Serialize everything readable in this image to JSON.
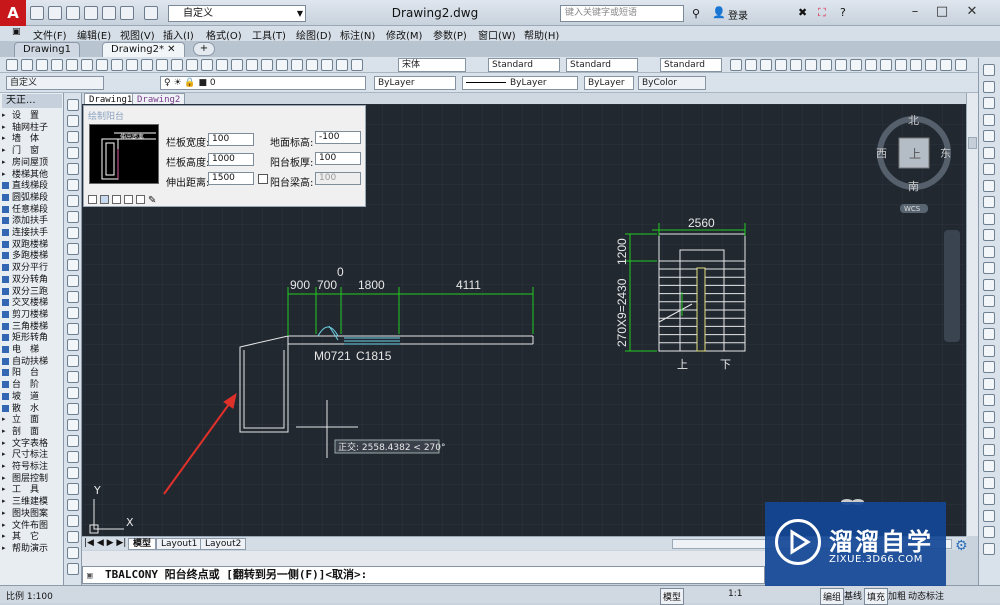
{
  "app": {
    "logo": "A",
    "title": "Drawing2.dwg",
    "workspace": "自定义",
    "search_placeholder": "键入关键字或短语",
    "login": "登录"
  },
  "menu": [
    "文件(F)",
    "编辑(E)",
    "视图(V)",
    "插入(I)",
    "格式(O)",
    "工具(T)",
    "绘图(D)",
    "标注(N)",
    "修改(M)",
    "参数(P)",
    "窗口(W)",
    "帮助(H)"
  ],
  "doc_tabs": [
    {
      "label": "Drawing1",
      "active": false
    },
    {
      "label": "Drawing2*",
      "active": true
    }
  ],
  "toolbar": {
    "font": "宋体",
    "text_style": "Standard",
    "dim_style": "Standard",
    "table_style": "Standard",
    "named_view": "自定义",
    "layer_color": "ByLayer",
    "linetype": "ByLayer",
    "lineweight": "ByLayer",
    "plot_style": "ByColor"
  },
  "tz_panel": {
    "header": "天正...",
    "items": [
      {
        "label": "设　置",
        "type": "grp"
      },
      {
        "label": "轴网柱子",
        "type": "grp"
      },
      {
        "label": "墙　体",
        "type": "grp"
      },
      {
        "label": "门　窗",
        "type": "grp"
      },
      {
        "label": "房间屋顶",
        "type": "grp"
      },
      {
        "label": "楼梯其他",
        "type": "grp"
      },
      {
        "label": "直线梯段",
        "type": "cmd"
      },
      {
        "label": "圆弧梯段",
        "type": "cmd"
      },
      {
        "label": "任意梯段",
        "type": "cmd"
      },
      {
        "label": "添加扶手",
        "type": "cmd"
      },
      {
        "label": "连接扶手",
        "type": "cmd"
      },
      {
        "label": "双跑楼梯",
        "type": "cmd"
      },
      {
        "label": "多跑楼梯",
        "type": "cmd"
      },
      {
        "label": "双分平行",
        "type": "cmd"
      },
      {
        "label": "双分转角",
        "type": "cmd"
      },
      {
        "label": "双分三跑",
        "type": "cmd"
      },
      {
        "label": "交叉楼梯",
        "type": "cmd"
      },
      {
        "label": "剪刀楼梯",
        "type": "cmd"
      },
      {
        "label": "三角楼梯",
        "type": "cmd"
      },
      {
        "label": "矩形转角",
        "type": "cmd"
      },
      {
        "label": "电　梯",
        "type": "cmd"
      },
      {
        "label": "自动扶梯",
        "type": "cmd"
      },
      {
        "label": "阳　台",
        "type": "cmd"
      },
      {
        "label": "台　阶",
        "type": "cmd"
      },
      {
        "label": "坡　道",
        "type": "cmd"
      },
      {
        "label": "散　水",
        "type": "cmd"
      },
      {
        "label": "立　面",
        "type": "grp"
      },
      {
        "label": "剖　面",
        "type": "grp"
      },
      {
        "label": "文字表格",
        "type": "grp"
      },
      {
        "label": "尺寸标注",
        "type": "grp"
      },
      {
        "label": "符号标注",
        "type": "grp"
      },
      {
        "label": "图层控制",
        "type": "grp"
      },
      {
        "label": "工　具",
        "type": "grp"
      },
      {
        "label": "三维建模",
        "type": "grp"
      },
      {
        "label": "图块图案",
        "type": "grp"
      },
      {
        "label": "文件布图",
        "type": "grp"
      },
      {
        "label": "其　它",
        "type": "grp"
      },
      {
        "label": "帮助演示",
        "type": "grp"
      }
    ]
  },
  "drawing_tabs": [
    "Drawing1",
    "Drawing2"
  ],
  "dialog": {
    "title": "绘制阳台",
    "preview_label": "伸出距离",
    "fields": [
      {
        "label": "栏板宽度:",
        "value": "100"
      },
      {
        "label": "地面标高:",
        "value": "-100"
      },
      {
        "label": "栏板高度:",
        "value": "1000"
      },
      {
        "label": "阳台板厚:",
        "value": "100"
      },
      {
        "label": "伸出距离:",
        "value": "1500"
      },
      {
        "label": "阳台梁高:",
        "value": "100"
      }
    ]
  },
  "drawing": {
    "dims": [
      "900",
      "700",
      "0",
      "1800",
      "4111"
    ],
    "door_label": "M0721",
    "window_label": "C1815",
    "stair_width": "2560",
    "stair_top": "1200",
    "stair_side": "270X9=2430",
    "up_label": "上",
    "down_label": "下",
    "tooltip": "正交: 2558.4382 < 270°",
    "ucs_y": "Y",
    "ucs_x": "X"
  },
  "viewcube": {
    "north": "北",
    "south": "南",
    "east": "东",
    "west": "西",
    "top": "上",
    "wcs": "WCS"
  },
  "layout_tabs": [
    {
      "label": "模型",
      "active": true
    },
    {
      "label": "Layout1",
      "active": false
    },
    {
      "label": "Layout2",
      "active": false
    }
  ],
  "command": {
    "prompt": "TBALCONY 阳台终点或 [翻转到另一侧(F)]<取消>:"
  },
  "status": {
    "scale": "比例 1:100",
    "model": "模型",
    "anno_scale": "1:1",
    "items": [
      "编组",
      "基线",
      "填充",
      "加粗",
      "动态标注"
    ]
  },
  "watermark": {
    "name": "溜溜自学",
    "url": "ZIXUE.3D66.COM"
  },
  "colors": {
    "canvas": "#212830",
    "dim": "#22cc22",
    "accent": "#c8171b"
  }
}
